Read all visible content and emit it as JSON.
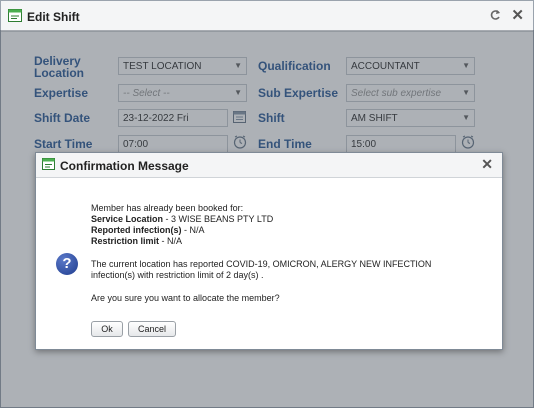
{
  "window": {
    "title": "Edit Shift",
    "icons": [
      "app-window-icon",
      "refresh-icon",
      "close-icon"
    ]
  },
  "form": {
    "delivery_location": {
      "label": "Delivery Location",
      "value": "TEST LOCATION"
    },
    "qualification": {
      "label": "Qualification",
      "value": "ACCOUNTANT"
    },
    "expertise": {
      "label": "Expertise",
      "placeholder": "-- Select --"
    },
    "sub_expertise": {
      "label": "Sub Expertise",
      "placeholder": "Select sub expertise"
    },
    "shift_date": {
      "label": "Shift Date",
      "value": "23-12-2022 Fri"
    },
    "shift": {
      "label": "Shift",
      "value": "AM SHIFT"
    },
    "start_time": {
      "label": "Start Time",
      "value": "07:00"
    },
    "end_time": {
      "label": "End Time",
      "value": "15:00"
    }
  },
  "dialog": {
    "title": "Confirmation Message",
    "intro": "Member has already been booked for:",
    "service_location_label": "Service Location",
    "service_location_value": " - 3 WISE BEANS PTY LTD",
    "reported_infections_label": "Reported infection(s)",
    "reported_infections_value": " - N/A",
    "restriction_limit_label": "Restriction limit",
    "restriction_limit_value": " - N/A",
    "warning_line1": "The current location has reported COVID-19, OMICRON, ALERGY NEW INFECTION",
    "warning_line2": "infection(s) with restriction limit of 2 day(s) .",
    "question": "Are you sure you want to allocate the member?",
    "ok_label": "Ok",
    "cancel_label": "Cancel",
    "icon": "question-icon"
  },
  "colors": {
    "label_blue": "#2f5d9a",
    "overlay": "rgba(60,70,80,0.42)"
  }
}
